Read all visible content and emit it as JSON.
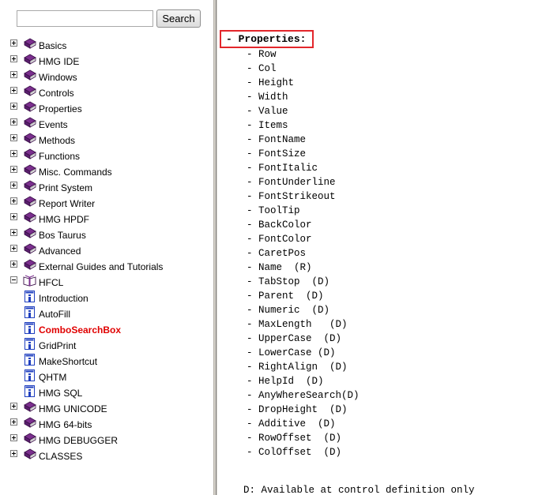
{
  "search": {
    "value": "",
    "button_label": "Search"
  },
  "tree": {
    "items": [
      {
        "label": "Basics",
        "type": "book",
        "expanded": false
      },
      {
        "label": "HMG IDE",
        "type": "book",
        "expanded": false
      },
      {
        "label": "Windows",
        "type": "book",
        "expanded": false
      },
      {
        "label": "Controls",
        "type": "book",
        "expanded": false
      },
      {
        "label": "Properties",
        "type": "book",
        "expanded": false
      },
      {
        "label": "Events",
        "type": "book",
        "expanded": false
      },
      {
        "label": "Methods",
        "type": "book",
        "expanded": false
      },
      {
        "label": "Functions",
        "type": "book",
        "expanded": false
      },
      {
        "label": "Misc. Commands",
        "type": "book",
        "expanded": false
      },
      {
        "label": "Print System",
        "type": "book",
        "expanded": false
      },
      {
        "label": "Report Writer",
        "type": "book",
        "expanded": false
      },
      {
        "label": "HMG HPDF",
        "type": "book",
        "expanded": false
      },
      {
        "label": "Bos Taurus",
        "type": "book",
        "expanded": false
      },
      {
        "label": "Advanced",
        "type": "book",
        "expanded": false
      },
      {
        "label": "External Guides and Tutorials",
        "type": "book",
        "expanded": false
      },
      {
        "label": "HFCL",
        "type": "open-book",
        "expanded": true
      },
      {
        "label": "Introduction",
        "type": "page",
        "active": false
      },
      {
        "label": "AutoFill",
        "type": "page",
        "active": false
      },
      {
        "label": "ComboSearchBox",
        "type": "page",
        "active": true
      },
      {
        "label": "GridPrint",
        "type": "page",
        "active": false
      },
      {
        "label": "MakeShortcut",
        "type": "page",
        "active": false
      },
      {
        "label": "QHTM",
        "type": "page",
        "active": false
      },
      {
        "label": "HMG SQL",
        "type": "page",
        "active": false
      },
      {
        "label": "HMG UNICODE",
        "type": "book",
        "expanded": false
      },
      {
        "label": "HMG 64-bits",
        "type": "book",
        "expanded": false
      },
      {
        "label": "HMG DEBUGGER",
        "type": "book",
        "expanded": false
      },
      {
        "label": "CLASSES",
        "type": "book",
        "expanded": false
      }
    ]
  },
  "content": {
    "heading": "- Properties:",
    "properties": [
      "- Row",
      "- Col",
      "- Height",
      "- Width",
      "- Value",
      "- Items",
      "- FontName",
      "- FontSize",
      "- FontItalic",
      "- FontUnderline",
      "- FontStrikeout",
      "- ToolTip",
      "- BackColor",
      "- FontColor",
      "- CaretPos",
      "- Name  (R)",
      "- TabStop  (D)",
      "- Parent  (D)",
      "- Numeric  (D)",
      "- MaxLength   (D)",
      "- UpperCase  (D)",
      "- LowerCase (D)",
      "- RightAlign  (D)",
      "- HelpId  (D)",
      "- AnyWhereSearch(D)",
      "- DropHeight  (D)",
      "- Additive  (D)",
      "- RowOffset  (D)",
      "- ColOffset  (D)"
    ],
    "footnote": "D: Available at control definition only"
  },
  "colors": {
    "active_link": "#e00000",
    "highlight_box": "#e3262b",
    "book_purple": "#7b2f8e",
    "page_blue": "#1f3fbf"
  }
}
